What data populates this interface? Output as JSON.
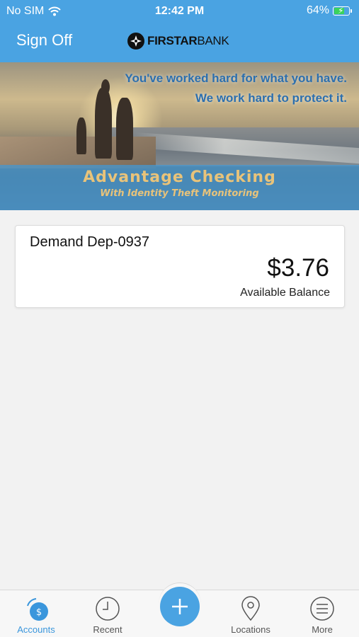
{
  "status_bar": {
    "carrier": "No SIM",
    "time": "12:42 PM",
    "battery": "64%"
  },
  "header": {
    "sign_off_label": "Sign Off",
    "logo_bold": "FIRSTAR",
    "logo_light": "BANK",
    "background_color": "#4aa3e2"
  },
  "banner": {
    "headline_line1": "You've worked hard for what you have.",
    "headline_line2": "We work hard to protect it.",
    "product_name": "Advantage Checking",
    "product_subtitle": "With Identity Theft Monitoring"
  },
  "accounts": [
    {
      "name": "Demand Dep-0937",
      "balance": "$3.76",
      "balance_label": "Available Balance"
    }
  ],
  "tab_bar": {
    "tabs": [
      {
        "label": "Accounts",
        "icon": "accounts-dollar-icon",
        "active": true
      },
      {
        "label": "Recent",
        "icon": "clock-icon",
        "active": false
      },
      {
        "label": "Locations",
        "icon": "map-pin-icon",
        "active": false
      },
      {
        "label": "More",
        "icon": "menu-icon",
        "active": false
      }
    ],
    "add_button_icon": "plus-icon",
    "active_color": "#3a96dc"
  }
}
